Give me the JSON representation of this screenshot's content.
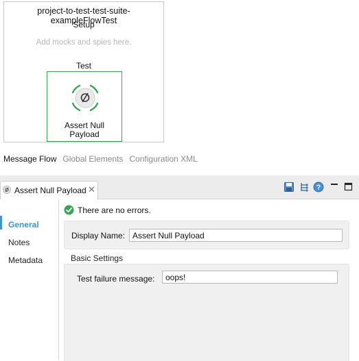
{
  "flow": {
    "title": "project-to-test-test-suite-exampleFlowTest",
    "setup_label": "Setup",
    "setup_hint": "Add mocks and spies here.",
    "test_label": "Test",
    "processor": {
      "label_line1": "Assert Null",
      "label_line2": "Payload",
      "icon": "null-symbol-icon",
      "accent_color": "#3aa655"
    }
  },
  "editor_tabs": [
    {
      "label": "Message Flow",
      "active": true
    },
    {
      "label": "Global Elements",
      "active": false
    },
    {
      "label": "Configuration XML",
      "active": false
    }
  ],
  "properties_view": {
    "tab_label": "Assert Null Payload",
    "close_glyph": "✕",
    "toolbar": [
      "save-icon",
      "tree-icon",
      "help-icon",
      "minimize-icon",
      "maximize-icon"
    ],
    "nav": [
      {
        "label": "General",
        "active": true
      },
      {
        "label": "Notes",
        "active": false
      },
      {
        "label": "Metadata",
        "active": false
      }
    ],
    "status_text": "There are no errors.",
    "display_name_label": "Display Name:",
    "display_name_value": "Assert Null Payload",
    "basic_settings_label": "Basic Settings",
    "failure_message_label": "Test failure message:",
    "failure_message_value": "oops!",
    "accent_color": "#3d94d1"
  }
}
